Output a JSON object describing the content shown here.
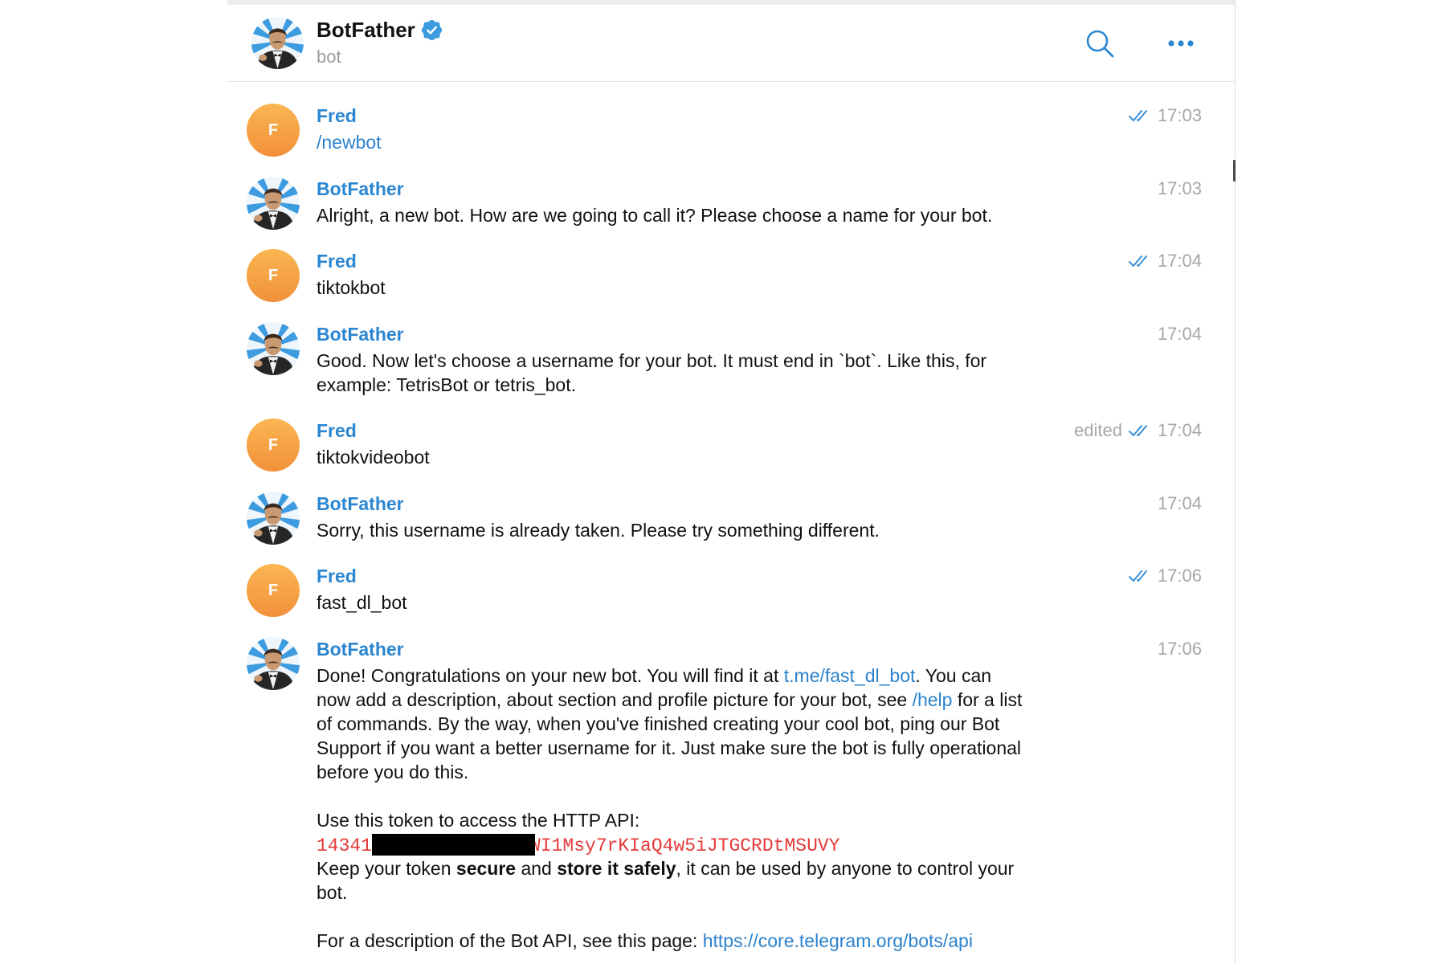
{
  "header": {
    "title": "BotFather",
    "subtitle": "bot",
    "avatar_icon": "botfather-avatar",
    "verified_icon": "verified-badge-icon",
    "search_icon": "search-icon",
    "more_icon": "more-icon"
  },
  "colors": {
    "accent": "#2a86d1",
    "link": "#2b82cc",
    "meta": "#a6a6a6",
    "code": "#e5393a",
    "fred_avatar_from": "#fab651",
    "fred_avatar_to": "#f2903a",
    "read_check": "#3a8fd8"
  },
  "messages": [
    {
      "sender": "Fred",
      "avatar_type": "initial",
      "initial": "F",
      "time": "17:03",
      "edited": "",
      "read": true,
      "lines": [
        [
          {
            "type": "link",
            "text": "/newbot"
          }
        ]
      ]
    },
    {
      "sender": "BotFather",
      "avatar_type": "photo",
      "time": "17:03",
      "edited": "",
      "read": false,
      "lines": [
        [
          {
            "type": "text",
            "text": "Alright, a new bot. How are we going to call it? Please choose a name for your bot."
          }
        ]
      ]
    },
    {
      "sender": "Fred",
      "avatar_type": "initial",
      "initial": "F",
      "time": "17:04",
      "edited": "",
      "read": true,
      "lines": [
        [
          {
            "type": "text",
            "text": "tiktokbot"
          }
        ]
      ]
    },
    {
      "sender": "BotFather",
      "avatar_type": "photo",
      "time": "17:04",
      "edited": "",
      "read": false,
      "lines": [
        [
          {
            "type": "text",
            "text": "Good. Now let's choose a username for your bot. It must end in `bot`. Like this, for"
          }
        ],
        [
          {
            "type": "text",
            "text": "example: TetrisBot or tetris_bot."
          }
        ]
      ]
    },
    {
      "sender": "Fred",
      "avatar_type": "initial",
      "initial": "F",
      "time": "17:04",
      "edited": "edited",
      "read": true,
      "lines": [
        [
          {
            "type": "text",
            "text": "tiktokvideobot"
          }
        ]
      ]
    },
    {
      "sender": "BotFather",
      "avatar_type": "photo",
      "time": "17:04",
      "edited": "",
      "read": false,
      "lines": [
        [
          {
            "type": "text",
            "text": "Sorry, this username is already taken. Please try something different."
          }
        ]
      ]
    },
    {
      "sender": "Fred",
      "avatar_type": "initial",
      "initial": "F",
      "time": "17:06",
      "edited": "",
      "read": true,
      "lines": [
        [
          {
            "type": "text",
            "text": "fast_dl_bot"
          }
        ]
      ]
    },
    {
      "sender": "BotFather",
      "avatar_type": "photo",
      "time": "17:06",
      "edited": "",
      "read": false,
      "lines": [
        [
          {
            "type": "text",
            "text": "Done! Congratulations on your new bot. You will find it at "
          },
          {
            "type": "link",
            "text": "t.me/fast_dl_bot"
          },
          {
            "type": "text",
            "text": ". You can"
          }
        ],
        [
          {
            "type": "text",
            "text": "now add a description, about section and profile picture for your bot, see "
          },
          {
            "type": "link",
            "text": "/help"
          },
          {
            "type": "text",
            "text": " for a list"
          }
        ],
        [
          {
            "type": "text",
            "text": "of commands. By the way, when you've finished creating your cool bot, ping our Bot"
          }
        ],
        [
          {
            "type": "text",
            "text": "Support if you want a better username for it. Just make sure the bot is fully operational"
          }
        ],
        [
          {
            "type": "text",
            "text": "before you do this."
          }
        ],
        [],
        [
          {
            "type": "text",
            "text": "Use this token to access the HTTP API:"
          }
        ],
        [
          {
            "type": "code",
            "text": "14341"
          },
          {
            "type": "redacted"
          },
          {
            "type": "code",
            "text": "WI1Msy7rKIaQ4w5iJTGCRDtMSUVY"
          }
        ],
        [
          {
            "type": "text",
            "text": "Keep your token "
          },
          {
            "type": "bold",
            "text": "secure"
          },
          {
            "type": "text",
            "text": " and "
          },
          {
            "type": "bold",
            "text": "store it safely"
          },
          {
            "type": "text",
            "text": ", it can be used by anyone to control your"
          }
        ],
        [
          {
            "type": "text",
            "text": "bot."
          }
        ],
        [],
        [
          {
            "type": "text",
            "text": "For a description of the Bot API, see this page: "
          },
          {
            "type": "link",
            "text": "https://core.telegram.org/bots/api"
          }
        ]
      ]
    }
  ]
}
